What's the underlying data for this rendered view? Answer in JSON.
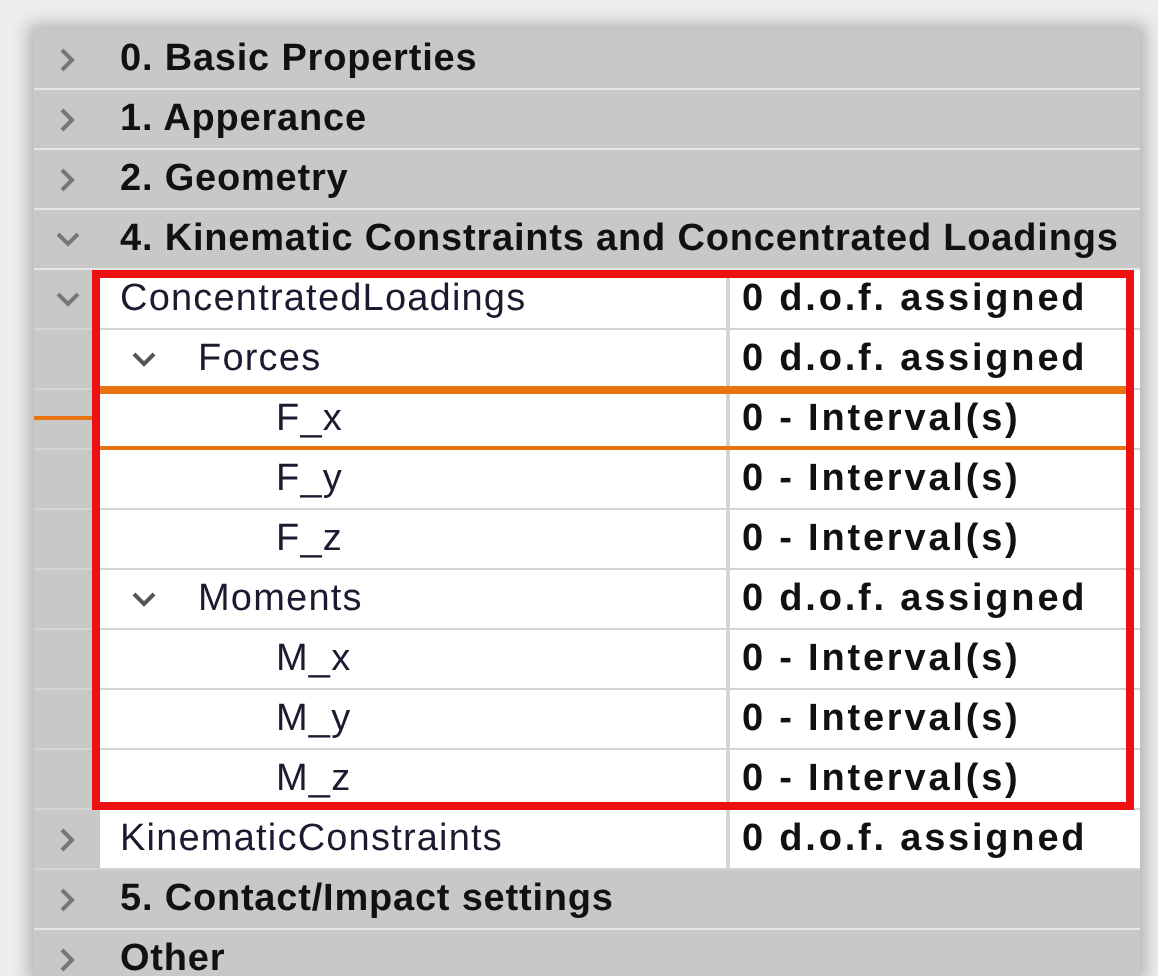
{
  "categories": [
    {
      "title": "0. Basic Properties",
      "expanded": false
    },
    {
      "title": "1. Apperance",
      "expanded": false
    },
    {
      "title": "2. Geometry",
      "expanded": false
    },
    {
      "title": "4. Kinematic Constraints and Concentrated Loadings",
      "expanded": true,
      "properties": [
        {
          "name": "ConcentratedLoadings",
          "value": "0 d.o.f. assigned",
          "expanded": true,
          "framed": true,
          "highlighted": false,
          "children": [
            {
              "name": "Forces",
              "value": "0 d.o.f. assigned",
              "expanded": true,
              "highlighted": false,
              "children": [
                {
                  "name": "F_x",
                  "value": "0 - Interval(s)",
                  "highlighted": true
                },
                {
                  "name": "F_y",
                  "value": "0 - Interval(s)",
                  "highlighted": false
                },
                {
                  "name": "F_z",
                  "value": "0 - Interval(s)",
                  "highlighted": false
                }
              ]
            },
            {
              "name": "Moments",
              "value": "0 d.o.f. assigned",
              "expanded": true,
              "highlighted": false,
              "children": [
                {
                  "name": "M_x",
                  "value": "0 - Interval(s)",
                  "highlighted": false
                },
                {
                  "name": "M_y",
                  "value": "0 - Interval(s)",
                  "highlighted": false
                },
                {
                  "name": "M_z",
                  "value": "0 - Interval(s)",
                  "highlighted": false
                }
              ]
            }
          ]
        },
        {
          "name": "KinematicConstraints",
          "value": "0 d.o.f. assigned",
          "expanded": false,
          "framed": false,
          "highlighted": false
        }
      ]
    },
    {
      "title": "5. Contact/Impact settings",
      "expanded": false
    },
    {
      "title": "Other",
      "expanded": false
    }
  ]
}
